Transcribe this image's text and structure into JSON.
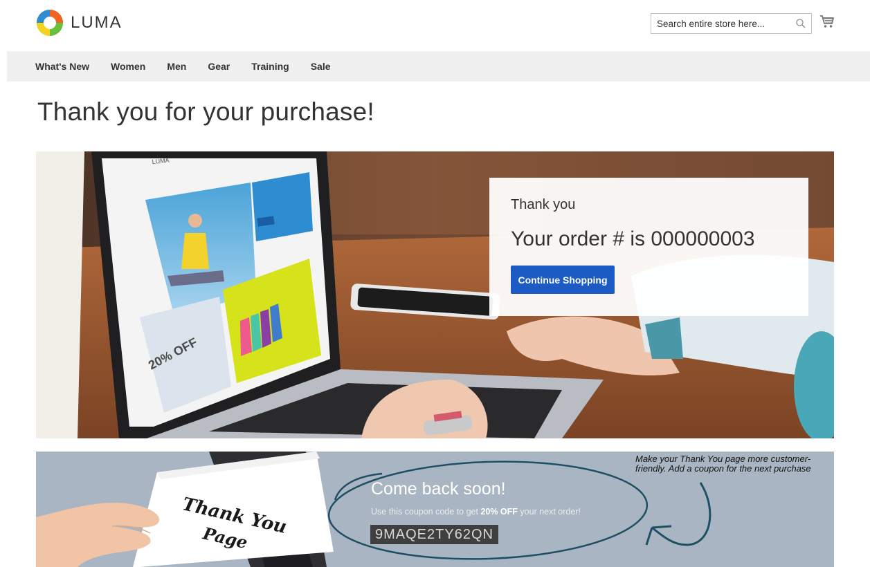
{
  "header": {
    "logo_text": "LUMA",
    "search_placeholder": "Search entire store here...",
    "colors": {
      "logo_orange": "#f26322",
      "logo_blue": "#2d8dd0",
      "logo_green": "#6bbf3a",
      "logo_yellow": "#f7d21a"
    }
  },
  "nav": {
    "items": [
      {
        "label": "What's New"
      },
      {
        "label": "Women"
      },
      {
        "label": "Men"
      },
      {
        "label": "Gear"
      },
      {
        "label": "Training"
      },
      {
        "label": "Sale"
      }
    ]
  },
  "main": {
    "title": "Thank you for your purchase!"
  },
  "order_box": {
    "thanks": "Thank you",
    "order_number": "Your order # is 000000003",
    "button_label": "Continue Shopping",
    "button_color": "#1d5bc4"
  },
  "coupon": {
    "heading": "Come back soon!",
    "desc_before": "Use this coupon code to get ",
    "desc_bold": "20% OFF",
    "desc_after": " your next order!",
    "code": "9MAQE2TY62QN",
    "card_text_line1": "Thank You",
    "card_text_line2": "Page",
    "annotation": "Make your Thank You page more customer-friendly. Add a coupon for the next purchase"
  },
  "laptop_screen": {
    "logo_text": "LUMA",
    "promo_text": "20% OFF"
  }
}
